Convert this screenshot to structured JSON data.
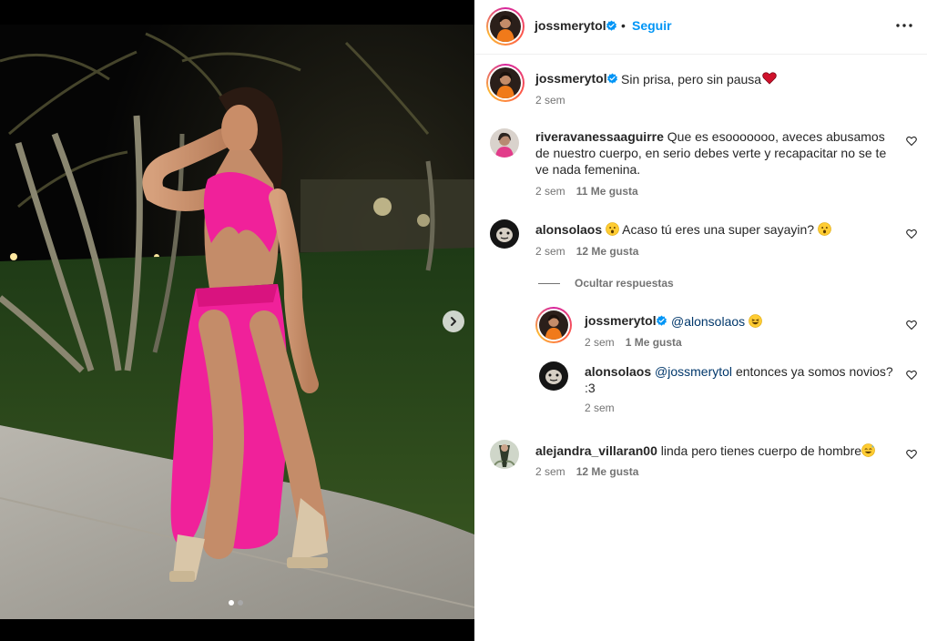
{
  "post": {
    "author": "jossmerytol",
    "follow_label": "Seguir",
    "separator": "•",
    "caption": "Sin prisa, pero sin pausa",
    "caption_time": "2 sem",
    "carousel_slides": 2,
    "carousel_active": 1
  },
  "comments": [
    {
      "user": "riveravanessaaguirre",
      "text": "Que es esooooooo, aveces abusamos de nuestro cuerpo, en serio debes verte y recapacitar no se te ve nada femenina.",
      "time": "2 sem",
      "likes": "11 Me gusta"
    },
    {
      "user": "alonsolaos",
      "text": "Acaso tú eres una super sayayin?",
      "time": "2 sem",
      "likes": "12 Me gusta"
    },
    {
      "user": "alejandra_villaran00",
      "text": "linda pero tienes cuerpo de hombre",
      "time": "2 sem",
      "likes": "12 Me gusta"
    }
  ],
  "replies_toggle": "Ocultar respuestas",
  "replies": [
    {
      "user": "jossmerytol",
      "mention": "@alonsolaos",
      "text": "",
      "time": "2 sem",
      "likes": "1 Me gusta"
    },
    {
      "user": "alonsolaos",
      "mention": "@jossmerytol",
      "text": "entonces ya somos novios? :3",
      "time": "2 sem",
      "likes": ""
    }
  ],
  "colors": {
    "link": "#0095f6",
    "verified": "#0095f6",
    "dress": "#f0219a",
    "mention": "#00376b"
  }
}
